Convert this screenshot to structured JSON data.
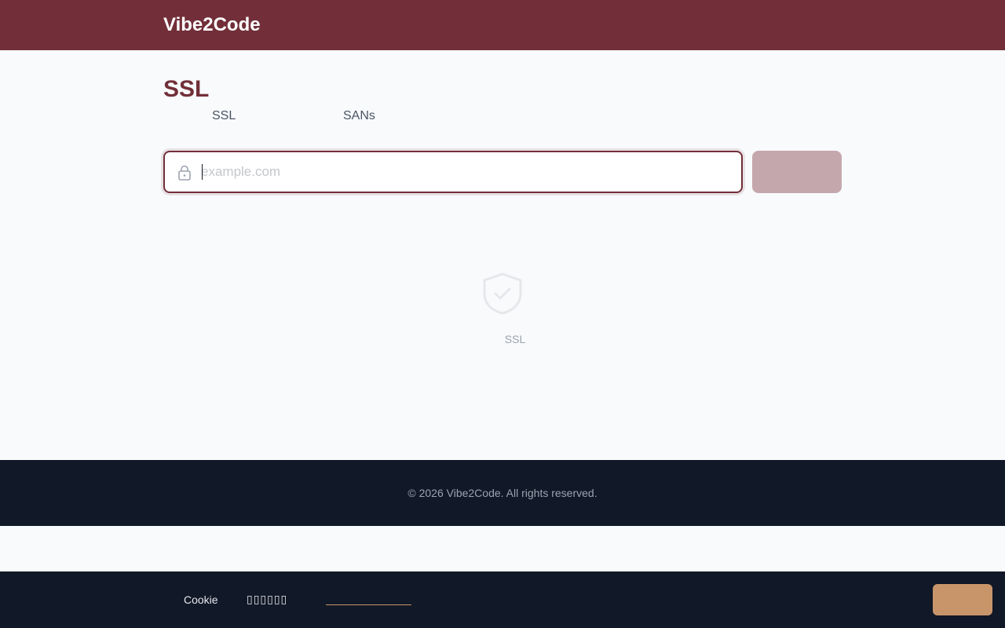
{
  "header": {
    "brand": "Vibe2Code"
  },
  "main": {
    "title": "SSL",
    "subtitle_part_1": "SSL",
    "subtitle_part_2": "SANs",
    "search": {
      "placeholder": "example.com",
      "value": "",
      "button_label": ""
    },
    "empty_state": {
      "icon": "shield-check-icon",
      "label": "SSL"
    }
  },
  "footer": {
    "copyright": "© 2026 Vibe2Code. All rights reserved."
  },
  "cookie_banner": {
    "label": "Cookie",
    "text": "▯▯▯▯▯▯",
    "link_text": "",
    "accept_label": ""
  },
  "colors": {
    "brand": "#722f39",
    "footer_bg": "#111827",
    "accent": "#c8956a",
    "button_disabled": "#c4a7ad"
  }
}
